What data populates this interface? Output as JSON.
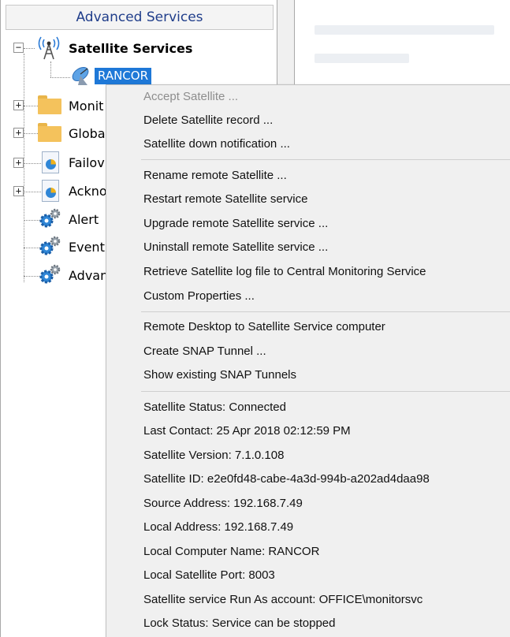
{
  "tree": {
    "header": "Advanced Services",
    "root_label": "Satellite Services",
    "selected_child": "RANCOR",
    "nodes": [
      {
        "label": "Monit",
        "kind": "folder",
        "expander": "+"
      },
      {
        "label": "Globa",
        "kind": "folder",
        "expander": "+"
      },
      {
        "label": "Failov",
        "kind": "report",
        "expander": "+"
      },
      {
        "label": "Ackno",
        "kind": "report",
        "expander": "+"
      },
      {
        "label": "Alert",
        "kind": "gear"
      },
      {
        "label": "Event",
        "kind": "gear"
      },
      {
        "label": "Advan",
        "kind": "gear"
      }
    ]
  },
  "context_menu": {
    "groups": [
      [
        {
          "label": "Accept Satellite ...",
          "disabled": true
        },
        {
          "label": "Delete Satellite record ...",
          "disabled": false
        },
        {
          "label": "Satellite down notification ...",
          "disabled": false
        }
      ],
      [
        {
          "label": "Rename remote Satellite ...",
          "disabled": false
        },
        {
          "label": "Restart remote Satellite service",
          "disabled": false
        },
        {
          "label": "Upgrade remote Satellite service ...",
          "disabled": false
        },
        {
          "label": "Uninstall remote Satellite service ...",
          "disabled": false
        },
        {
          "label": "Retrieve Satellite log file to Central Monitoring Service",
          "disabled": false
        },
        {
          "label": "Custom Properties ...",
          "disabled": false
        }
      ],
      [
        {
          "label": "Remote Desktop to Satellite Service computer",
          "disabled": false
        },
        {
          "label": "Create SNAP Tunnel ...",
          "disabled": false
        },
        {
          "label": "Show existing SNAP Tunnels",
          "disabled": false
        }
      ],
      [
        {
          "label": "Satellite Status: Connected",
          "disabled": false
        },
        {
          "label": "Last Contact: 25 Apr 2018 02:12:59 PM",
          "disabled": false
        },
        {
          "label": "Satellite Version: 7.1.0.108",
          "disabled": false
        },
        {
          "label": "Satellite ID: e2e0fd48-cabe-4a3d-994b-a202ad4daa98",
          "disabled": false
        },
        {
          "label": "Source Address: 192.168.7.49",
          "disabled": false
        },
        {
          "label": "Local Address: 192.168.7.49",
          "disabled": false
        },
        {
          "label": "Local Computer Name: RANCOR",
          "disabled": false
        },
        {
          "label": "Local Satellite Port: 8003",
          "disabled": false
        },
        {
          "label": "Satellite service Run As account: OFFICE\\monitorsvc",
          "disabled": false
        },
        {
          "label": "Lock Status: Service can be stopped",
          "disabled": false
        }
      ]
    ]
  },
  "colors": {
    "selection": "#1e78d7",
    "header_text": "#1f3d8a",
    "menu_bg": "#f0f0f0",
    "disabled_text": "#8d8d8d"
  },
  "icons": {
    "root": "satellite-tower-icon",
    "child": "satellite-dish-icon",
    "folder": "folder-icon",
    "report": "report-icon",
    "gear": "gear-icon"
  }
}
